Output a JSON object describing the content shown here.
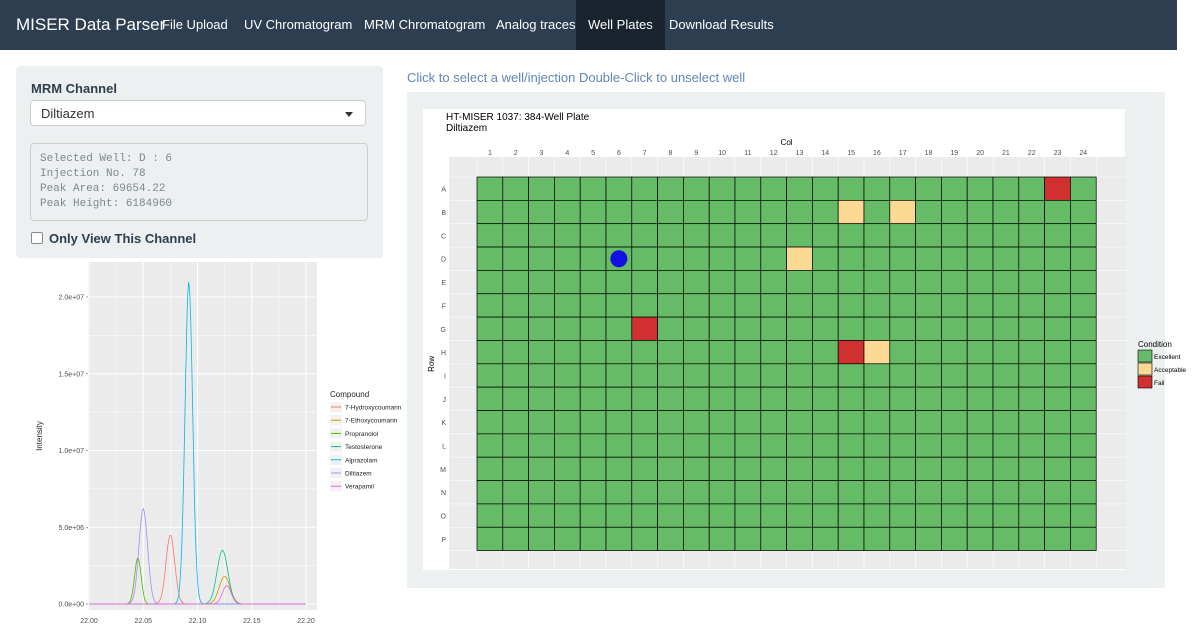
{
  "app": {
    "title": "MISER Data Parser"
  },
  "nav": {
    "tabs": [
      {
        "label": "File Upload"
      },
      {
        "label": "UV Chromatogram"
      },
      {
        "label": "MRM Chromatogram"
      },
      {
        "label": "Analog traces"
      },
      {
        "label": "Well Plates",
        "active": true
      },
      {
        "label": "Download Results"
      }
    ]
  },
  "sidebar": {
    "channel_label": "MRM Channel",
    "channel_value": "Diltiazem",
    "info_lines": [
      "Selected Well: D : 6",
      "Injection No. 78",
      "Peak Area: 69654.22",
      "Peak Height: 6184960"
    ],
    "only_view_label": "Only View This Channel",
    "only_view_checked": false
  },
  "help_text": "Click to select a well/injection Double-Click to unselect well",
  "plate": {
    "title": "HT-MISER 1037: 384-Well Plate",
    "subtitle": "Diltiazem",
    "x_label": "Col",
    "y_label": "Row",
    "columns": [
      "1",
      "2",
      "3",
      "4",
      "5",
      "6",
      "7",
      "8",
      "9",
      "10",
      "11",
      "12",
      "13",
      "14",
      "15",
      "16",
      "17",
      "18",
      "19",
      "20",
      "21",
      "22",
      "23",
      "24"
    ],
    "rows": [
      "A",
      "B",
      "C",
      "D",
      "E",
      "F",
      "G",
      "H",
      "I",
      "J",
      "K",
      "L",
      "M",
      "N",
      "O",
      "P"
    ],
    "default_condition": "Excellent",
    "exceptions": [
      {
        "row": "A",
        "col": 23,
        "condition": "Fail"
      },
      {
        "row": "B",
        "col": 15,
        "condition": "Acceptable"
      },
      {
        "row": "B",
        "col": 17,
        "condition": "Acceptable"
      },
      {
        "row": "D",
        "col": 13,
        "condition": "Acceptable"
      },
      {
        "row": "G",
        "col": 7,
        "condition": "Fail"
      },
      {
        "row": "H",
        "col": 15,
        "condition": "Fail"
      },
      {
        "row": "H",
        "col": 16,
        "condition": "Acceptable"
      }
    ],
    "selected_well": {
      "row": "D",
      "col": 6
    },
    "legend_title": "Condition",
    "legend": [
      {
        "label": "Excellent",
        "color": "#66bb66"
      },
      {
        "label": "Acceptable",
        "color": "#fbd992"
      },
      {
        "label": "Fail",
        "color": "#d03030"
      }
    ],
    "selected_color": "#1010e0"
  },
  "chart_data": {
    "type": "line",
    "xlabel": "",
    "ylabel": "Intensity",
    "x_ticks": [
      "22.00",
      "22.05",
      "22.10",
      "22.15",
      "22.20"
    ],
    "y_ticks": [
      "0.0e+00",
      "5.0e+06",
      "1.0e+07",
      "1.5e+07",
      "2.0e+07"
    ],
    "xlim": [
      22.0,
      22.2
    ],
    "ylim": [
      0,
      20000000
    ],
    "legend_title": "Compound",
    "series": [
      {
        "name": "7-Hydroxycoumarin",
        "color": "#f8766d",
        "peaks": [
          [
            22.075,
            4500000,
            0.004
          ]
        ]
      },
      {
        "name": "7-Ethoxycoumarin",
        "color": "#c49a00",
        "peaks": [
          [
            22.125,
            1800000,
            0.005
          ]
        ]
      },
      {
        "name": "Propranolol",
        "color": "#53b400",
        "peaks": [
          [
            22.045,
            3000000,
            0.003
          ]
        ]
      },
      {
        "name": "Testosterone",
        "color": "#00c094",
        "peaks": [
          [
            22.123,
            3500000,
            0.005
          ]
        ]
      },
      {
        "name": "Alprazolam",
        "color": "#00b6eb",
        "peaks": [
          [
            22.092,
            21000000,
            0.0035
          ]
        ]
      },
      {
        "name": "Diltiazem",
        "color": "#a58aff",
        "peaks": [
          [
            22.05,
            6200000,
            0.004
          ]
        ]
      },
      {
        "name": "Verapamil",
        "color": "#fb61d7",
        "peaks": [
          [
            22.127,
            1200000,
            0.004
          ]
        ]
      }
    ]
  }
}
